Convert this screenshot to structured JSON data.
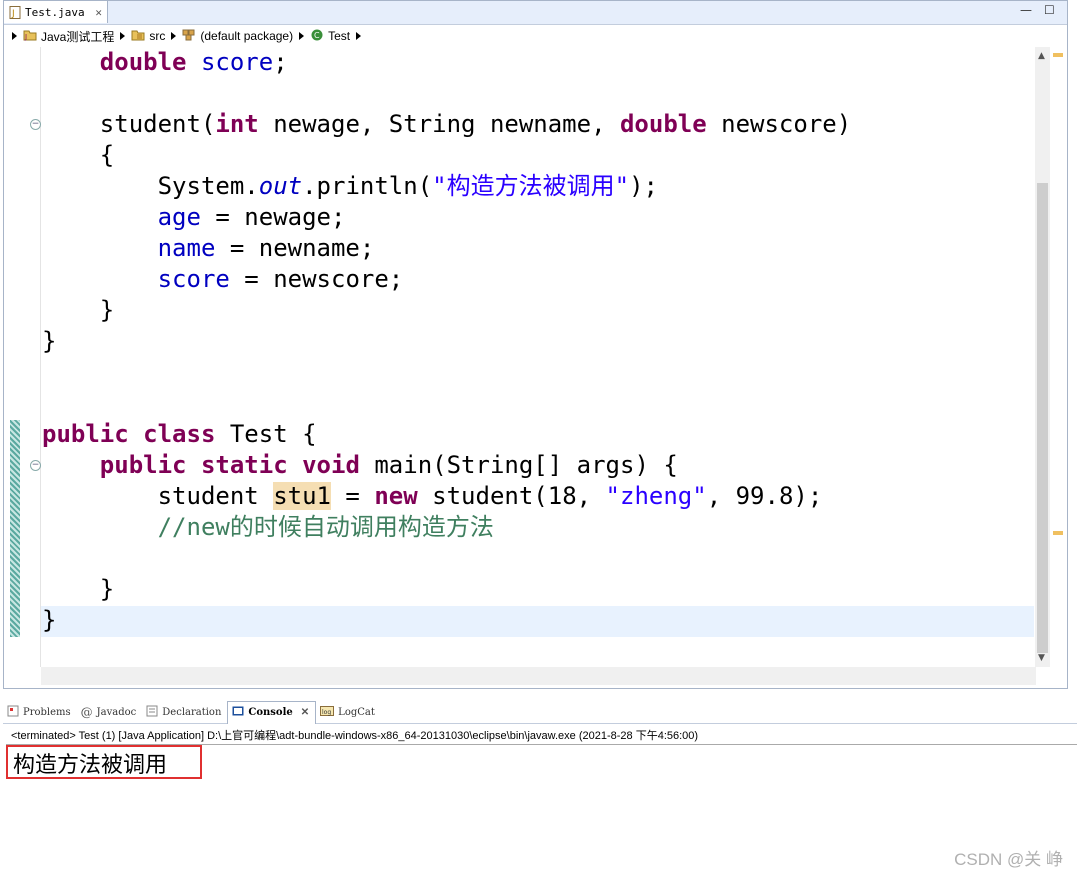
{
  "editor": {
    "tab_title": "Test.java",
    "breadcrumb": [
      "Java测试工程",
      "src",
      "(default package)",
      "Test"
    ],
    "code_lines": [
      {
        "tokens": [
          {
            "t": "    "
          },
          {
            "t": "double",
            "c": "kw"
          },
          {
            "t": " "
          },
          {
            "t": "score",
            "c": "fld"
          },
          {
            "t": ";"
          }
        ]
      },
      {
        "tokens": []
      },
      {
        "tokens": [
          {
            "t": "    student("
          },
          {
            "t": "int",
            "c": "kw"
          },
          {
            "t": " newage, String newname, "
          },
          {
            "t": "double",
            "c": "kw"
          },
          {
            "t": " newscore)"
          }
        ]
      },
      {
        "tokens": [
          {
            "t": "    {"
          }
        ]
      },
      {
        "tokens": [
          {
            "t": "        System."
          },
          {
            "t": "out",
            "c": "ital"
          },
          {
            "t": ".println("
          },
          {
            "t": "\"构造方法被调用\"",
            "c": "str"
          },
          {
            "t": ");"
          }
        ]
      },
      {
        "tokens": [
          {
            "t": "        "
          },
          {
            "t": "age",
            "c": "fld"
          },
          {
            "t": " = newage;"
          }
        ]
      },
      {
        "tokens": [
          {
            "t": "        "
          },
          {
            "t": "name",
            "c": "fld"
          },
          {
            "t": " = newname;"
          }
        ]
      },
      {
        "tokens": [
          {
            "t": "        "
          },
          {
            "t": "score",
            "c": "fld"
          },
          {
            "t": " = newscore;"
          }
        ]
      },
      {
        "tokens": [
          {
            "t": "    }"
          }
        ]
      },
      {
        "tokens": [
          {
            "t": "}"
          }
        ]
      },
      {
        "tokens": []
      },
      {
        "tokens": []
      },
      {
        "tokens": [
          {
            "t": "public",
            "c": "kw"
          },
          {
            "t": " "
          },
          {
            "t": "class",
            "c": "kw"
          },
          {
            "t": " Test {"
          }
        ]
      },
      {
        "tokens": [
          {
            "t": "    "
          },
          {
            "t": "public",
            "c": "kw"
          },
          {
            "t": " "
          },
          {
            "t": "static",
            "c": "kw"
          },
          {
            "t": " "
          },
          {
            "t": "void",
            "c": "kw"
          },
          {
            "t": " main(String[] args) {"
          }
        ]
      },
      {
        "tokens": [
          {
            "t": "        student "
          },
          {
            "t": "stu1",
            "c": "hl-occ"
          },
          {
            "t": " = "
          },
          {
            "t": "new",
            "c": "kw"
          },
          {
            "t": " student(18, "
          },
          {
            "t": "\"zheng\"",
            "c": "str"
          },
          {
            "t": ", 99.8);"
          }
        ]
      },
      {
        "tokens": [
          {
            "t": "        "
          },
          {
            "t": "//new的时候自动调用构造方法",
            "c": "cmt"
          }
        ]
      },
      {
        "tokens": []
      },
      {
        "tokens": [
          {
            "t": "    }"
          }
        ]
      },
      {
        "tokens": [
          {
            "t": "}"
          }
        ]
      }
    ]
  },
  "console": {
    "tabs": [
      {
        "label": "Problems",
        "icon": "problems-icon"
      },
      {
        "label": "Javadoc",
        "icon": "javadoc-icon"
      },
      {
        "label": "Declaration",
        "icon": "declaration-icon"
      },
      {
        "label": "Console",
        "icon": "console-icon",
        "active": true
      },
      {
        "label": "LogCat",
        "icon": "logcat-icon"
      }
    ],
    "status": "<terminated> Test (1) [Java Application] D:\\上官可编程\\adt-bundle-windows-x86_64-20131030\\eclipse\\bin\\javaw.exe (2021-8-28 下午4:56:00)",
    "output": "构造方法被调用"
  },
  "watermark": "CSDN @关 峥"
}
